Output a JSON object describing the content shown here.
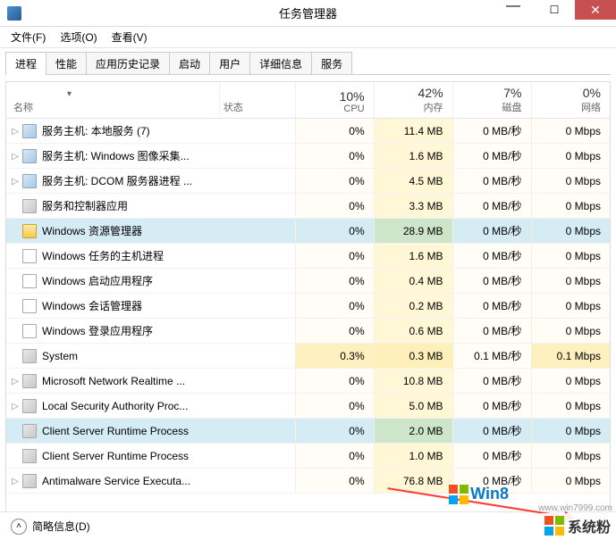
{
  "window": {
    "title": "任务管理器",
    "min": "—",
    "max": "☐",
    "close": "✕"
  },
  "menu": {
    "file": "文件(F)",
    "options": "选项(O)",
    "view": "查看(V)"
  },
  "tabs": [
    "进程",
    "性能",
    "应用历史记录",
    "启动",
    "用户",
    "详细信息",
    "服务"
  ],
  "columns": {
    "name": "名称",
    "status": "状态",
    "cpu_pct": "10%",
    "cpu": "CPU",
    "mem_pct": "42%",
    "mem": "内存",
    "disk_pct": "7%",
    "disk": "磁盘",
    "net_pct": "0%",
    "net": "网络",
    "sort_caret": "▾"
  },
  "processes": [
    {
      "exp": true,
      "icon": "gear-blue",
      "name": "服务主机: 本地服务 (7)",
      "cpu": "0%",
      "mem": "11.4 MB",
      "disk": "0 MB/秒",
      "net": "0 Mbps"
    },
    {
      "exp": true,
      "icon": "gear-blue",
      "name": "服务主机: Windows 图像采集...",
      "cpu": "0%",
      "mem": "1.6 MB",
      "disk": "0 MB/秒",
      "net": "0 Mbps"
    },
    {
      "exp": true,
      "icon": "gear-blue",
      "name": "服务主机: DCOM 服务器进程 ...",
      "cpu": "0%",
      "mem": "4.5 MB",
      "disk": "0 MB/秒",
      "net": "0 Mbps"
    },
    {
      "exp": false,
      "icon": "gear",
      "name": "服务和控制器应用",
      "cpu": "0%",
      "mem": "3.3 MB",
      "disk": "0 MB/秒",
      "net": "0 Mbps"
    },
    {
      "exp": false,
      "icon": "folder",
      "name": "Windows 资源管理器",
      "cpu": "0%",
      "mem": "28.9 MB",
      "disk": "0 MB/秒",
      "net": "0 Mbps",
      "selected": true
    },
    {
      "exp": false,
      "icon": "app",
      "name": "Windows 任务的主机进程",
      "cpu": "0%",
      "mem": "1.6 MB",
      "disk": "0 MB/秒",
      "net": "0 Mbps"
    },
    {
      "exp": false,
      "icon": "app",
      "name": "Windows 启动应用程序",
      "cpu": "0%",
      "mem": "0.4 MB",
      "disk": "0 MB/秒",
      "net": "0 Mbps"
    },
    {
      "exp": false,
      "icon": "app",
      "name": "Windows 会话管理器",
      "cpu": "0%",
      "mem": "0.2 MB",
      "disk": "0 MB/秒",
      "net": "0 Mbps"
    },
    {
      "exp": false,
      "icon": "app",
      "name": "Windows 登录应用程序",
      "cpu": "0%",
      "mem": "0.6 MB",
      "disk": "0 MB/秒",
      "net": "0 Mbps"
    },
    {
      "exp": false,
      "icon": "gear",
      "name": "System",
      "cpu": "0.3%",
      "mem": "0.3 MB",
      "disk": "0.1 MB/秒",
      "net": "0.1 Mbps",
      "hot": true
    },
    {
      "exp": true,
      "icon": "gear",
      "name": "Microsoft Network Realtime ...",
      "cpu": "0%",
      "mem": "10.8 MB",
      "disk": "0 MB/秒",
      "net": "0 Mbps"
    },
    {
      "exp": true,
      "icon": "gear",
      "name": "Local Security Authority Proc...",
      "cpu": "0%",
      "mem": "5.0 MB",
      "disk": "0 MB/秒",
      "net": "0 Mbps"
    },
    {
      "exp": false,
      "icon": "gear",
      "name": "Client Server Runtime Process",
      "cpu": "0%",
      "mem": "2.0 MB",
      "disk": "0 MB/秒",
      "net": "0 Mbps",
      "selected": true
    },
    {
      "exp": false,
      "icon": "gear",
      "name": "Client Server Runtime Process",
      "cpu": "0%",
      "mem": "1.0 MB",
      "disk": "0 MB/秒",
      "net": "0 Mbps"
    },
    {
      "exp": true,
      "icon": "gear",
      "name": "Antimalware Service Executa...",
      "cpu": "0%",
      "mem": "76.8 MB",
      "disk": "0 MB/秒",
      "net": "0 Mbps"
    }
  ],
  "footer": {
    "fewer_details": "简略信息(D)",
    "chevron": "˄",
    "scroll_down": "▾"
  },
  "watermark": {
    "brand": "Win8",
    "corner": "系统粉",
    "url": "www.win7999.com"
  }
}
